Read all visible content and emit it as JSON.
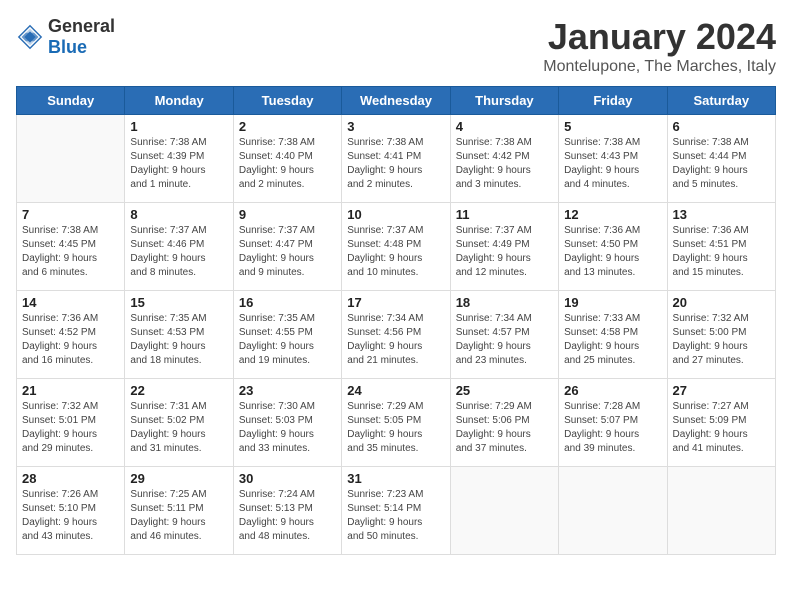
{
  "header": {
    "logo_general": "General",
    "logo_blue": "Blue",
    "month": "January 2024",
    "location": "Montelupone, The Marches, Italy"
  },
  "days_of_week": [
    "Sunday",
    "Monday",
    "Tuesday",
    "Wednesday",
    "Thursday",
    "Friday",
    "Saturday"
  ],
  "weeks": [
    [
      {
        "day": "",
        "info": ""
      },
      {
        "day": "1",
        "info": "Sunrise: 7:38 AM\nSunset: 4:39 PM\nDaylight: 9 hours\nand 1 minute."
      },
      {
        "day": "2",
        "info": "Sunrise: 7:38 AM\nSunset: 4:40 PM\nDaylight: 9 hours\nand 2 minutes."
      },
      {
        "day": "3",
        "info": "Sunrise: 7:38 AM\nSunset: 4:41 PM\nDaylight: 9 hours\nand 2 minutes."
      },
      {
        "day": "4",
        "info": "Sunrise: 7:38 AM\nSunset: 4:42 PM\nDaylight: 9 hours\nand 3 minutes."
      },
      {
        "day": "5",
        "info": "Sunrise: 7:38 AM\nSunset: 4:43 PM\nDaylight: 9 hours\nand 4 minutes."
      },
      {
        "day": "6",
        "info": "Sunrise: 7:38 AM\nSunset: 4:44 PM\nDaylight: 9 hours\nand 5 minutes."
      }
    ],
    [
      {
        "day": "7",
        "info": "Sunrise: 7:38 AM\nSunset: 4:45 PM\nDaylight: 9 hours\nand 6 minutes."
      },
      {
        "day": "8",
        "info": "Sunrise: 7:37 AM\nSunset: 4:46 PM\nDaylight: 9 hours\nand 8 minutes."
      },
      {
        "day": "9",
        "info": "Sunrise: 7:37 AM\nSunset: 4:47 PM\nDaylight: 9 hours\nand 9 minutes."
      },
      {
        "day": "10",
        "info": "Sunrise: 7:37 AM\nSunset: 4:48 PM\nDaylight: 9 hours\nand 10 minutes."
      },
      {
        "day": "11",
        "info": "Sunrise: 7:37 AM\nSunset: 4:49 PM\nDaylight: 9 hours\nand 12 minutes."
      },
      {
        "day": "12",
        "info": "Sunrise: 7:36 AM\nSunset: 4:50 PM\nDaylight: 9 hours\nand 13 minutes."
      },
      {
        "day": "13",
        "info": "Sunrise: 7:36 AM\nSunset: 4:51 PM\nDaylight: 9 hours\nand 15 minutes."
      }
    ],
    [
      {
        "day": "14",
        "info": "Sunrise: 7:36 AM\nSunset: 4:52 PM\nDaylight: 9 hours\nand 16 minutes."
      },
      {
        "day": "15",
        "info": "Sunrise: 7:35 AM\nSunset: 4:53 PM\nDaylight: 9 hours\nand 18 minutes."
      },
      {
        "day": "16",
        "info": "Sunrise: 7:35 AM\nSunset: 4:55 PM\nDaylight: 9 hours\nand 19 minutes."
      },
      {
        "day": "17",
        "info": "Sunrise: 7:34 AM\nSunset: 4:56 PM\nDaylight: 9 hours\nand 21 minutes."
      },
      {
        "day": "18",
        "info": "Sunrise: 7:34 AM\nSunset: 4:57 PM\nDaylight: 9 hours\nand 23 minutes."
      },
      {
        "day": "19",
        "info": "Sunrise: 7:33 AM\nSunset: 4:58 PM\nDaylight: 9 hours\nand 25 minutes."
      },
      {
        "day": "20",
        "info": "Sunrise: 7:32 AM\nSunset: 5:00 PM\nDaylight: 9 hours\nand 27 minutes."
      }
    ],
    [
      {
        "day": "21",
        "info": "Sunrise: 7:32 AM\nSunset: 5:01 PM\nDaylight: 9 hours\nand 29 minutes."
      },
      {
        "day": "22",
        "info": "Sunrise: 7:31 AM\nSunset: 5:02 PM\nDaylight: 9 hours\nand 31 minutes."
      },
      {
        "day": "23",
        "info": "Sunrise: 7:30 AM\nSunset: 5:03 PM\nDaylight: 9 hours\nand 33 minutes."
      },
      {
        "day": "24",
        "info": "Sunrise: 7:29 AM\nSunset: 5:05 PM\nDaylight: 9 hours\nand 35 minutes."
      },
      {
        "day": "25",
        "info": "Sunrise: 7:29 AM\nSunset: 5:06 PM\nDaylight: 9 hours\nand 37 minutes."
      },
      {
        "day": "26",
        "info": "Sunrise: 7:28 AM\nSunset: 5:07 PM\nDaylight: 9 hours\nand 39 minutes."
      },
      {
        "day": "27",
        "info": "Sunrise: 7:27 AM\nSunset: 5:09 PM\nDaylight: 9 hours\nand 41 minutes."
      }
    ],
    [
      {
        "day": "28",
        "info": "Sunrise: 7:26 AM\nSunset: 5:10 PM\nDaylight: 9 hours\nand 43 minutes."
      },
      {
        "day": "29",
        "info": "Sunrise: 7:25 AM\nSunset: 5:11 PM\nDaylight: 9 hours\nand 46 minutes."
      },
      {
        "day": "30",
        "info": "Sunrise: 7:24 AM\nSunset: 5:13 PM\nDaylight: 9 hours\nand 48 minutes."
      },
      {
        "day": "31",
        "info": "Sunrise: 7:23 AM\nSunset: 5:14 PM\nDaylight: 9 hours\nand 50 minutes."
      },
      {
        "day": "",
        "info": ""
      },
      {
        "day": "",
        "info": ""
      },
      {
        "day": "",
        "info": ""
      }
    ]
  ]
}
